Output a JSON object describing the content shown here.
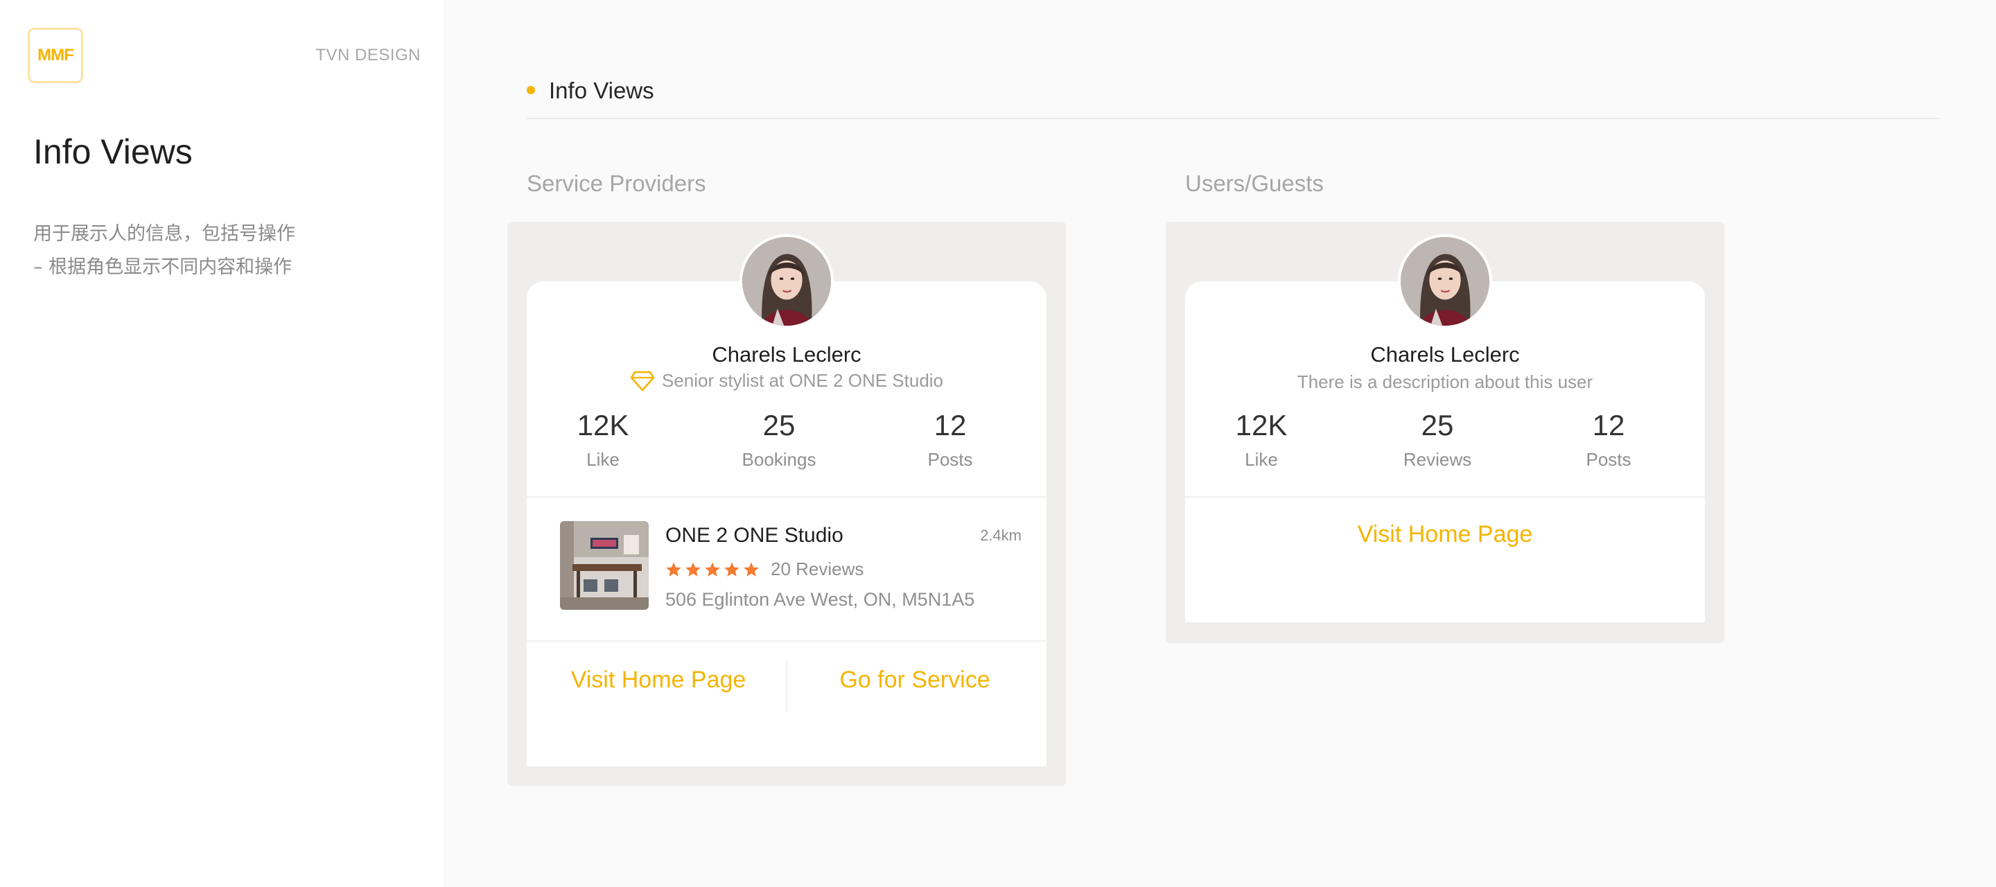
{
  "sidebar": {
    "logo_text": "MMF",
    "brand": "TVN DESIGN",
    "title": "Info Views",
    "desc_line1": "用于展示人的信息，包括号操作",
    "desc_line2": "– 根据角色显示不同内容和操作"
  },
  "section": {
    "title": "Info Views"
  },
  "columns": {
    "left_label": "Service Providers",
    "right_label": "Users/Guests"
  },
  "provider_card": {
    "name": "Charels Leclerc",
    "subtitle": "Senior stylist at ONE 2 ONE Studio",
    "stats": [
      {
        "value": "12K",
        "label": "Like"
      },
      {
        "value": "25",
        "label": "Bookings"
      },
      {
        "value": "12",
        "label": "Posts"
      }
    ],
    "studio": {
      "name": "ONE 2 ONE Studio",
      "distance": "2.4km",
      "rating": 5,
      "reviews": "20 Reviews",
      "address": "506 Eglinton Ave West, ON, M5N1A5"
    },
    "actions": {
      "visit": "Visit Home Page",
      "service": "Go for Service"
    }
  },
  "guest_card": {
    "name": "Charels Leclerc",
    "subtitle": "There is a description about this user",
    "stats": [
      {
        "value": "12K",
        "label": "Like"
      },
      {
        "value": "25",
        "label": "Reviews"
      },
      {
        "value": "12",
        "label": "Posts"
      }
    ],
    "actions": {
      "visit": "Visit Home Page"
    }
  },
  "colors": {
    "accent": "#f5b400",
    "star": "#f47b30",
    "panel": "#efeeec"
  },
  "icons": {
    "badge": "diamond-icon",
    "rating": "star-icon"
  }
}
